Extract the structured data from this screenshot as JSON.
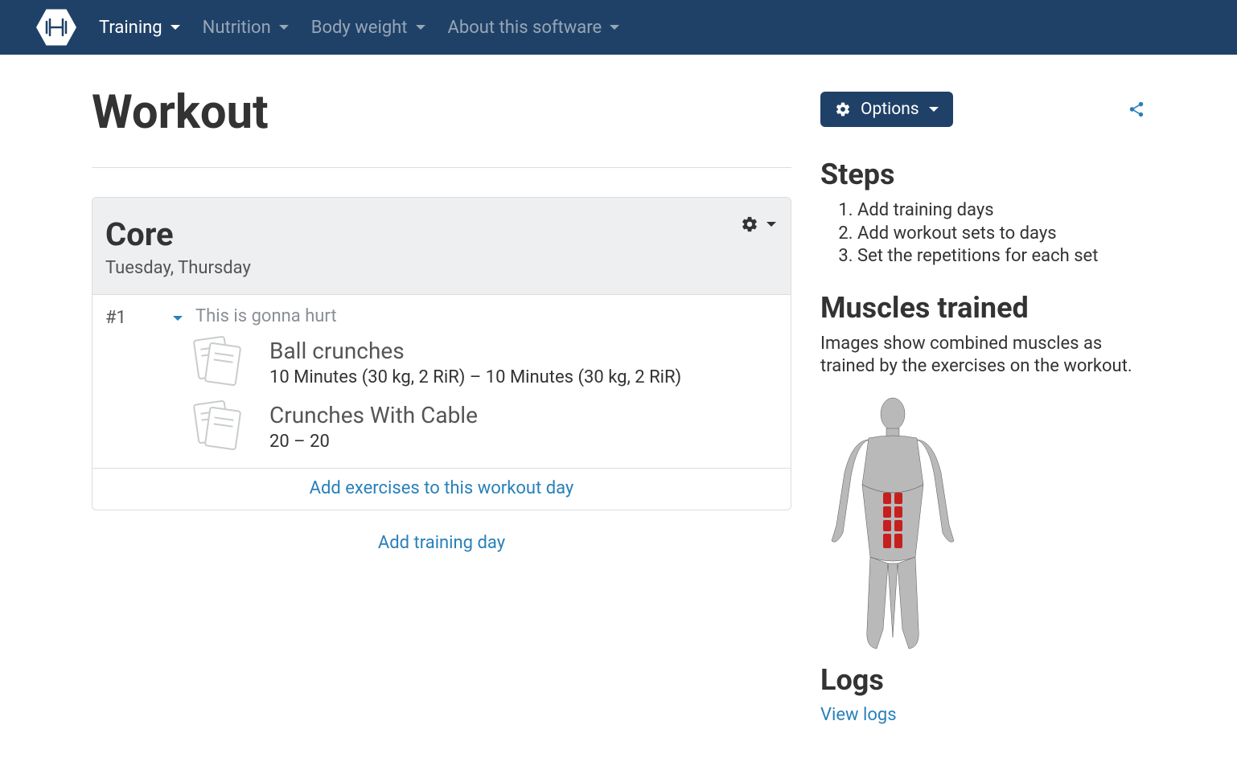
{
  "nav": {
    "items": [
      {
        "label": "Training",
        "active": true
      },
      {
        "label": "Nutrition",
        "active": false
      },
      {
        "label": "Body weight",
        "active": false
      },
      {
        "label": "About this software",
        "active": false
      }
    ]
  },
  "page": {
    "title": "Workout"
  },
  "workout_day": {
    "name": "Core",
    "days_text": "Tuesday, Thursday",
    "set_number": "#1",
    "set_note": "This is gonna hurt",
    "exercises": [
      {
        "name": "Ball crunches",
        "detail": "10 Minutes (30 kg, 2 RiR) – 10 Minutes (30 kg, 2 RiR)"
      },
      {
        "name": "Crunches With Cable",
        "detail": "20 – 20"
      }
    ],
    "add_exercises_label": "Add exercises to this workout day"
  },
  "add_day_label": "Add training day",
  "options": {
    "button_label": "Options"
  },
  "steps": {
    "heading": "Steps",
    "items": [
      "Add training days",
      "Add workout sets to days",
      "Set the repetitions for each set"
    ]
  },
  "muscles": {
    "heading": "Muscles trained",
    "description": "Images show combined muscles as trained by the exercises on the workout."
  },
  "logs": {
    "heading": "Logs",
    "view_label": "View logs"
  },
  "colors": {
    "brand": "#204167",
    "link": "#2880ba"
  }
}
